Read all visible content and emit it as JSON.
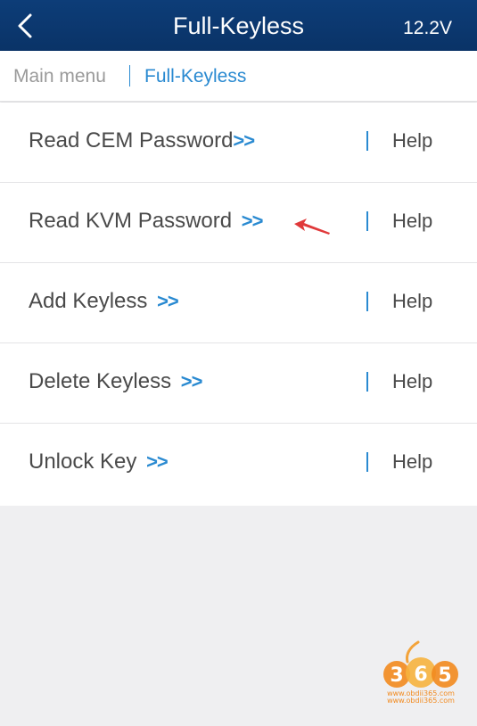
{
  "header": {
    "title": "Full-Keyless",
    "voltage": "12.2V"
  },
  "breadcrumb": {
    "main": "Main menu",
    "current": "Full-Keyless"
  },
  "menu": {
    "items": [
      {
        "label": "Read CEM Password",
        "arrow": ">>",
        "help": "Help"
      },
      {
        "label": "Read KVM Password",
        "arrow": ">>",
        "help": "Help"
      },
      {
        "label": "Add Keyless",
        "arrow": ">>",
        "help": "Help"
      },
      {
        "label": "Delete Keyless",
        "arrow": ">>",
        "help": "Help"
      },
      {
        "label": "Unlock Key",
        "arrow": ">>",
        "help": "Help"
      }
    ]
  },
  "watermark": {
    "logo": "365",
    "url1": "www.obdii365.com",
    "url2": "www.obdii365.com"
  },
  "colors": {
    "header_bg": "#0b3a73",
    "accent": "#2a8ad1",
    "annotation_arrow": "#e0393a"
  }
}
